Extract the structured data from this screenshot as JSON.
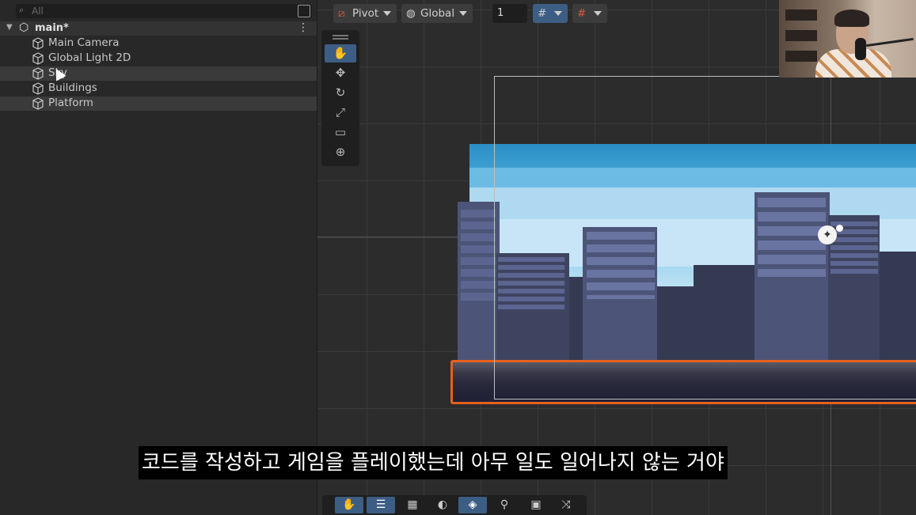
{
  "hierarchy": {
    "search_placeholder": "All",
    "scene_name": "main*",
    "items": [
      {
        "label": "Main Camera"
      },
      {
        "label": "Global Light 2D"
      },
      {
        "label": "Sky"
      },
      {
        "label": "Buildings"
      },
      {
        "label": "Platform"
      }
    ],
    "icons": {
      "search": "search-icon",
      "lock": "lock-icon",
      "scene": "unity-scene-icon",
      "more": "more-options-icon",
      "gameobject": "cube-icon"
    }
  },
  "scene_toolbar": {
    "pivot_label": "Pivot",
    "global_label": "Global",
    "grid_snap_value": "1"
  },
  "tools": [
    "hand-tool-icon",
    "move-tool-icon",
    "rotate-tool-icon",
    "scale-tool-icon",
    "rect-tool-icon",
    "transform-tool-icon"
  ],
  "bottom_tools": [
    "hand-icon",
    "inspector-icon",
    "grid-icon",
    "lighting-icon",
    "layers-icon",
    "search-icon",
    "camera-icon",
    "shuffle-icon"
  ],
  "subtitle": "코드를 작성하고 게임을 플레이했는데 아무 일도 일어나지 않는 거야",
  "colors": {
    "selection": "#3d5e84",
    "platform_outline": "#e8601c",
    "sky_top": "#2a8fc6"
  }
}
